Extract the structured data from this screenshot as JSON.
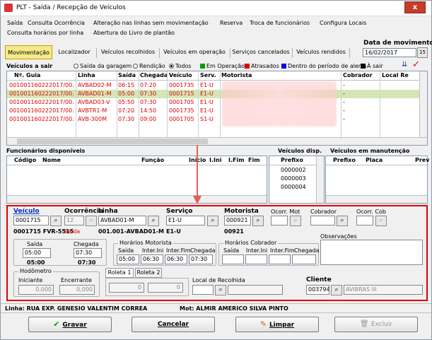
{
  "window": {
    "title": "PLT - Saída / Recepção de Veículos",
    "close": "x"
  },
  "menu": {
    "row1": [
      "Saída",
      "Consulta Ocorrência",
      "Alteração nas linhas sem movimentação",
      "Reserva",
      "Troca de funcionários",
      "Configura Locais"
    ],
    "row2": [
      "Consulta horários por linha",
      "Abertura do Livro de plantão"
    ]
  },
  "tabs": [
    "Movimentação",
    "Localizador",
    "Veículos recolhidos",
    "Veículos em operação",
    "Serviços cancelados",
    "Veículos rendidos"
  ],
  "data_movimento": {
    "label": "Data de movimento",
    "value": "16/02/2017",
    "button": "15"
  },
  "veiculos_a_sair": {
    "title": "Veículos a sair",
    "filters": [
      "Saída da garagem",
      "Rendição",
      "Todos"
    ],
    "selected_filter": "Todos",
    "legend": [
      {
        "label": "Em Operação",
        "color": "#00a000"
      },
      {
        "label": "Atrasados",
        "color": "#e00000"
      },
      {
        "label": "Dentro do período de alerta",
        "color": "#0000e0"
      },
      {
        "label": "À sair",
        "color": "#000000"
      }
    ],
    "columns": [
      "Nº. Guia",
      "Linha",
      "Saída",
      "Chegada",
      "Veículo",
      "Serv.",
      "Motorista",
      "Cobrador",
      "Local Re"
    ],
    "rows": [
      {
        "guia": "001001160222017/00...",
        "linha": "AVBAD02-M",
        "saida": "06:15",
        "chegada": "07:20",
        "veiculo": "0001735",
        "serv": "E1-U",
        "cobrador": "-",
        "state": "late"
      },
      {
        "guia": "001001160222017/00...",
        "linha": "AVBAD01-M",
        "saida": "05:00",
        "chegada": "07:30",
        "veiculo": "0001715",
        "serv": "E1-U",
        "cobrador": "-",
        "state": "selected"
      },
      {
        "guia": "001001160222017/00...",
        "linha": "AVBAD03-V",
        "saida": "05:50",
        "chegada": "07:30",
        "veiculo": "0001705",
        "serv": "E1-U",
        "cobrador": "-",
        "state": "late"
      },
      {
        "guia": "001001160222017/00...",
        "linha": "AVBTR1-M",
        "saida": "07:20",
        "chegada": "14:50",
        "veiculo": "0001735",
        "serv": "E1-U",
        "cobrador": "-",
        "state": "late"
      },
      {
        "guia": "001001160222017/00...",
        "linha": "AVB-300M",
        "saida": "07:30",
        "chegada": "09:00",
        "veiculo": "0001705",
        "serv": "S1-U",
        "cobrador": "-",
        "state": "late"
      }
    ]
  },
  "funcionarios": {
    "title": "Funcionários disponíveis",
    "columns": [
      "Código",
      "Nome",
      "Função",
      "Início",
      "I.Ini",
      "I.Fim",
      "Fim"
    ]
  },
  "veiculos_disp": {
    "title": "Veículos disp.",
    "column": "Prefixo",
    "items": [
      "0000002",
      "0000003",
      "0000004"
    ]
  },
  "veiculos_manut": {
    "title": "Veículos em manutenção",
    "columns": [
      "Prefixo",
      "Placa",
      "Prev"
    ]
  },
  "detail": {
    "veiculo": {
      "label": "Veículo",
      "value": "0001715",
      "sub": "0001715 FVR-5515"
    },
    "ocorrencia": {
      "label": "Ocorrência",
      "value": "12",
      "sub": "Saída"
    },
    "linha": {
      "label": "Linha",
      "value": "AVBAD01-M",
      "sub": "001.001-AVBAD01-M"
    },
    "servico": {
      "label": "Serviço",
      "value": "E1-U",
      "sub": "E1-U"
    },
    "motorista": {
      "label": "Motorista",
      "value": "000921",
      "sub": "00921"
    },
    "ocorr_mot": {
      "label": "Ocorr. Mot",
      "value": ""
    },
    "cobrador": {
      "label": "Cobrador",
      "value": ""
    },
    "ocorr_cob": {
      "label": "Ocorr. Cob",
      "value": ""
    },
    "saida": {
      "label": "Saída",
      "value": "05:00",
      "sub": "05:00"
    },
    "chegada": {
      "label": "Chegada",
      "value": "07:30",
      "sub": "07:30"
    },
    "horarios_motorista": {
      "label": "Horários Motorista",
      "cols": [
        "Saída",
        "Inter.Ini",
        "Inter.Fim",
        "Chegada"
      ],
      "values": [
        "05:00",
        "06:30",
        "06:30",
        "07:30"
      ]
    },
    "horarios_cobrador": {
      "label": "Horários Cobrador",
      "cols": [
        "Saída",
        "Inter.Ini",
        "Inter.Fim",
        "Chegada"
      ],
      "values": [
        "",
        "",
        "",
        ""
      ]
    },
    "observacoes": {
      "label": "Observações",
      "value": ""
    },
    "hodometro": {
      "label": "Hodômetro",
      "iniciante_label": "Iniciante",
      "encerrante_label": "Encerrante",
      "iniciante": "0,000",
      "encerrante": "0,000"
    },
    "roleta_tabs": [
      "Roleta 1",
      "Roleta 2"
    ],
    "roleta_values": [
      "0",
      "0"
    ],
    "local_recolhida": {
      "label": "Local de Recolhida",
      "value": ""
    },
    "cliente": {
      "label": "Cliente",
      "code": "003794",
      "name": "AVIBRAS III"
    }
  },
  "status": {
    "linha": "Linha: RUA EXP. GENESIO VALENTIM CORREA",
    "mot": "Mot: ALMIR AMERICO SILVA PINTO"
  },
  "buttons": {
    "gravar": "Gravar",
    "cancelar": "Cancelar",
    "limpar": "Limpar",
    "excluir": "Excluir"
  },
  "colors": {
    "highlight_border": "#e00000",
    "selected_row": "#d4e6b5",
    "active_tab": "#f6e98a",
    "late_text": "#e00000"
  }
}
